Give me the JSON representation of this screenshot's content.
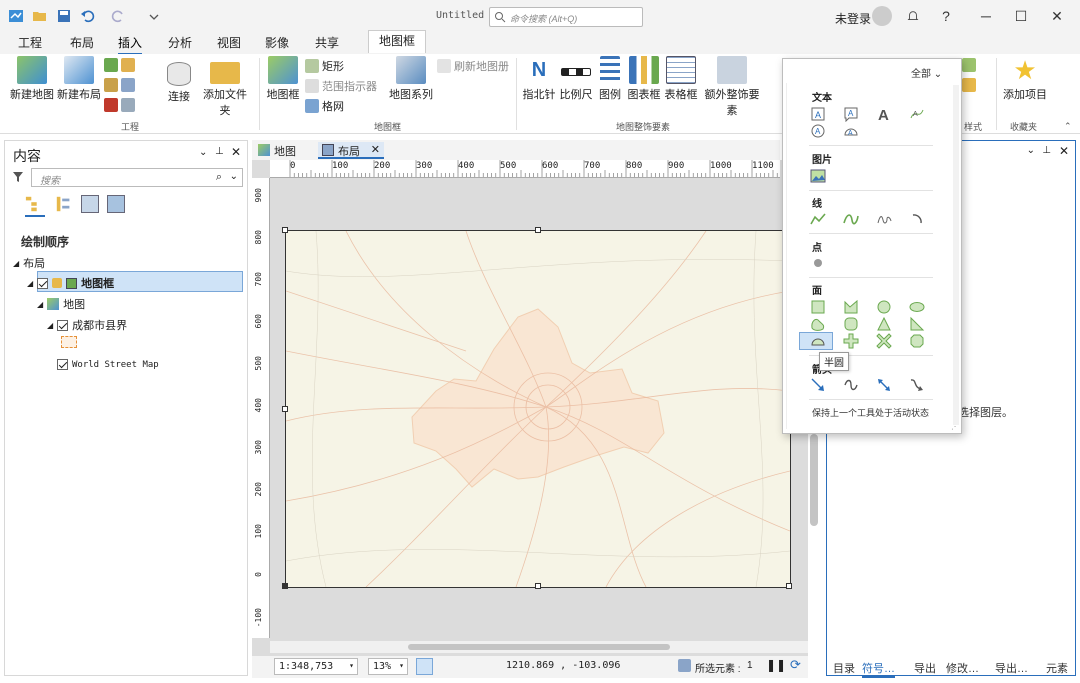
{
  "window": {
    "title": "Untitled",
    "command_search_placeholder": "命令搜索 (Alt+Q)",
    "signin": "未登录",
    "help": "?"
  },
  "ribbon_tabs": {
    "project": "工程",
    "layout": "布局",
    "insert": "插入",
    "analysis": "分析",
    "view": "视图",
    "imagery": "影像",
    "share": "共享",
    "map_frame": "地图框"
  },
  "ribbon": {
    "new_map": "新建地图",
    "new_layout": "新建布局",
    "connect": "连接",
    "add_folder": "添加文件夹",
    "group_project": "工程",
    "map_frame": "地图框",
    "rectangle": "矩形",
    "extent_indicator": "范围指示器",
    "grid": "格网",
    "map_series": "地图系列",
    "refresh_map_series": "刷新地图册",
    "group_map_frame": "地图框",
    "north_arrow": "指北针",
    "scale_bar": "比例尺",
    "legend": "图例",
    "chart_frame": "图表框",
    "table_frame": "表格框",
    "extra_surround": "额外整饰要素",
    "group_surround": "地图整饰要素",
    "group_styles": "样式",
    "add_item": "添加项目",
    "group_favorites": "收藏夹"
  },
  "contents": {
    "title": "内容",
    "search_placeholder": "搜索",
    "drawing_order": "绘制顺序",
    "layout_root": "布局",
    "map_frame": "地图框",
    "map": "地图",
    "layer_boundary": "成都市县界",
    "basemap": "World Street Map"
  },
  "view_tabs": {
    "map_tab": "地图",
    "layout_tab": "布局"
  },
  "rulers": {
    "top": [
      "0",
      "100",
      "200",
      "300",
      "400",
      "500",
      "600",
      "700",
      "800",
      "900",
      "1000",
      "1100"
    ],
    "left": [
      "900",
      "800",
      "700",
      "600",
      "500",
      "400",
      "300",
      "200",
      "100",
      "0",
      "-100"
    ]
  },
  "status": {
    "scale": "1:348,753",
    "zoom": "13%",
    "coords": "1210.869 , -103.096",
    "selected_label": "所选元素 :",
    "selected_count": "1"
  },
  "right_pane": {
    "hint": "选择图层。",
    "tabs": [
      "目录",
      "符号…",
      "导出",
      "修改…",
      "导出…",
      "元素"
    ]
  },
  "gallery": {
    "filter": "全部",
    "sections": {
      "text": "文本",
      "picture": "图片",
      "line": "线",
      "point": "点",
      "polygon": "面",
      "arrow": "箭头"
    },
    "tooltip": "半圆",
    "footer": "保持上一个工具处于活动状态"
  },
  "colors": {
    "accent": "#2a6ebb",
    "map_bg": "#f6f4e6",
    "road": "#e8b69a"
  }
}
